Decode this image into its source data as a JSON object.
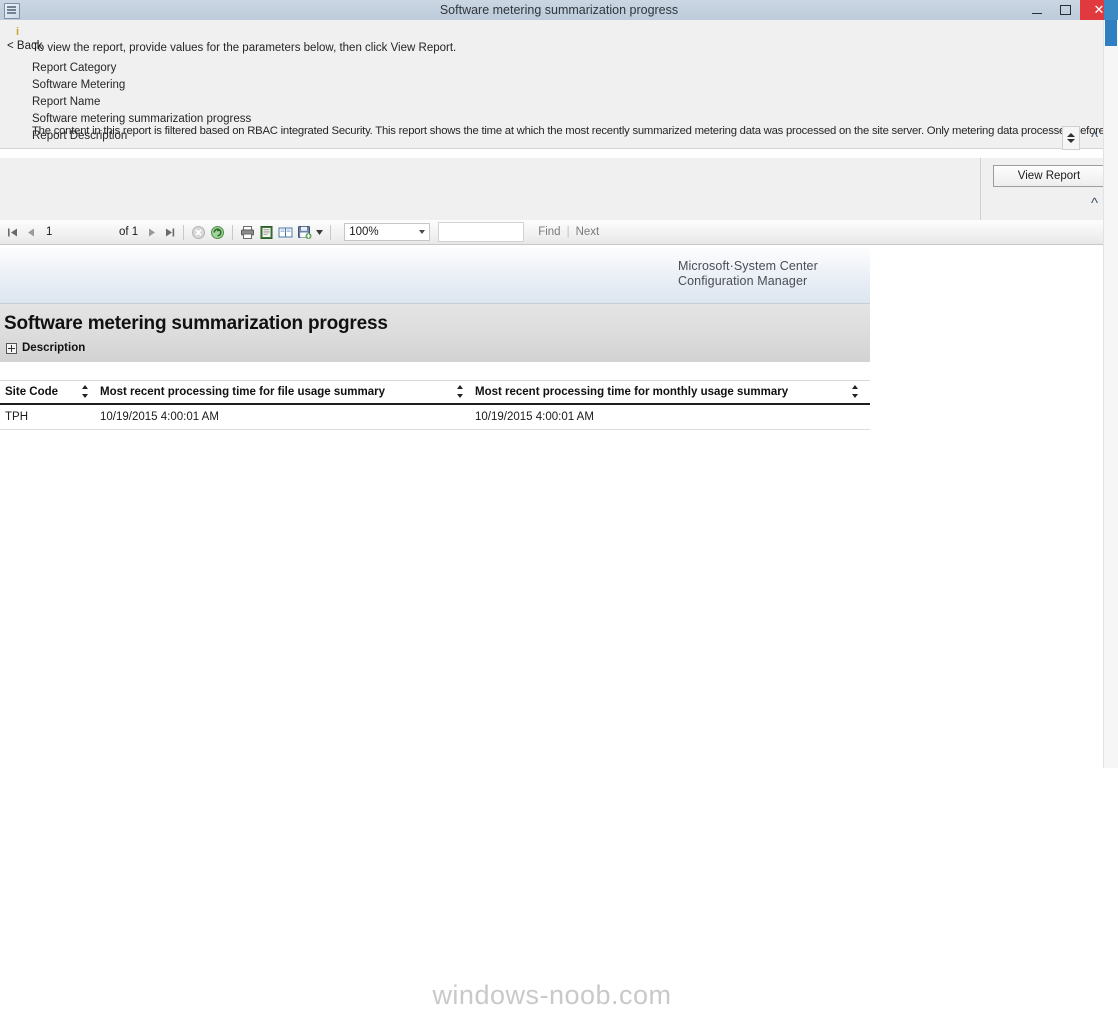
{
  "window": {
    "title": "Software metering summarization progress",
    "icon": "report-window-icon",
    "minimize_label": "–",
    "maximize_label": "□",
    "close_label": "✕"
  },
  "parameters_pane": {
    "info_icon": "information-icon",
    "hint": "To view the report, provide values for the parameters below, then click View Report.",
    "fields": [
      {
        "label": "Report Category",
        "value": "Software Metering"
      },
      {
        "label": "Report Name",
        "value": "Software metering summarization progress"
      },
      {
        "label": "Report Description",
        "value": ""
      }
    ],
    "description_text": "The content in this report is filtered based on RBAC integrated Security. This report shows the time at which the most recently summarized metering data was processed on the site server.  Only metering data processed before these dates will be",
    "spinner_up": "spin-up-arrow",
    "spinner_down": "spin-down-arrow",
    "collapse_label": "«"
  },
  "action_pane": {
    "back_label": "< Back",
    "view_report_label": "View Report",
    "collapse_label": "«"
  },
  "viewer_toolbar": {
    "first_page_icon": "⏮",
    "prev_page_icon": "◀",
    "page_value": "1",
    "page_placeholder": "1",
    "of_label": "of 1",
    "next_page_icon": "▶",
    "last_page_icon": "⏭",
    "stop_icon": "stop-icon",
    "refresh_icon": "refresh-icon",
    "print_icon": "print-icon",
    "print_layout_icon": "print-layout-icon",
    "page_setup_icon": "page-setup-icon",
    "export_icon": "export-save-icon",
    "export_dropdown_icon": "chevron-down-icon",
    "zoom_value": "100%",
    "find_value": "",
    "find_placeholder": "",
    "find_label": "Find",
    "find_separator": "|",
    "next_label": "Next"
  },
  "report": {
    "brand_line1": "Microsoft·System Center",
    "brand_line2": "Configuration Manager",
    "title": "Software metering summarization progress",
    "description_toggle_label": "Description",
    "description_toggle_icon": "expand-plus-icon",
    "table": {
      "columns": [
        "Site Code",
        "Most recent processing time for file usage summary",
        "Most recent processing time for monthly usage summary"
      ],
      "sort_icon": "sort-toggle-icon",
      "rows": [
        [
          "TPH",
          "10/19/2015 4:00:01 AM",
          "10/19/2015 4:00:01 AM"
        ]
      ]
    },
    "watermark": "windows-noob.com"
  },
  "colors": {
    "titlebar": "#c3d0de",
    "close_button": "#e03a3f",
    "scrollbar_thumb": "#2f7ec1",
    "accent_brand": "#4a4f55"
  }
}
